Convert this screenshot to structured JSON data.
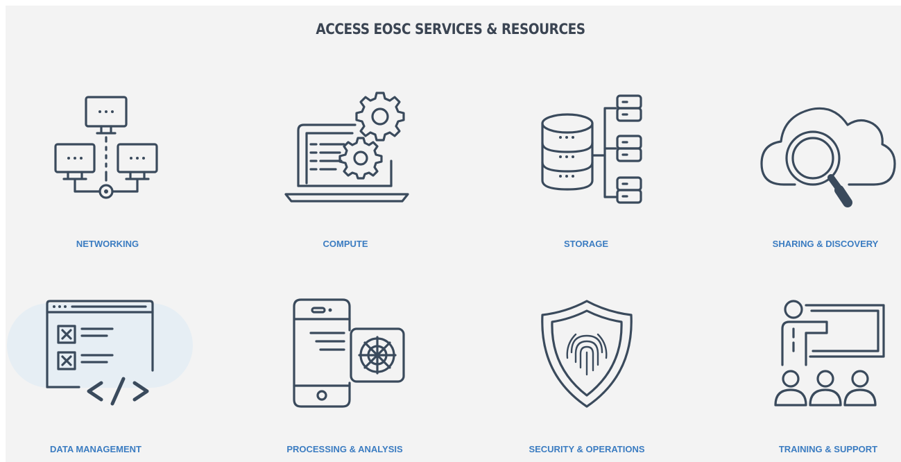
{
  "title": "ACCESS EOSC SERVICES & RESOURCES",
  "services": [
    {
      "label": "NETWORKING",
      "icon": "network-icon"
    },
    {
      "label": "COMPUTE",
      "icon": "laptop-gear-icon"
    },
    {
      "label": "STORAGE",
      "icon": "database-storage-icon"
    },
    {
      "label": "SHARING & DISCOVERY",
      "icon": "cloud-search-icon"
    },
    {
      "label": "DATA MANAGEMENT",
      "icon": "code-window-icon"
    },
    {
      "label": "PROCESSING & ANALYSIS",
      "icon": "phone-processor-icon"
    },
    {
      "label": "SECURITY & OPERATIONS",
      "icon": "fingerprint-shield-icon"
    },
    {
      "label": "TRAINING & SUPPORT",
      "icon": "presentation-audience-icon"
    }
  ],
  "colors": {
    "title": "#3a4452",
    "label": "#3b7cc1",
    "icon": "#3a4a5c",
    "background": "#f3f3f3"
  }
}
